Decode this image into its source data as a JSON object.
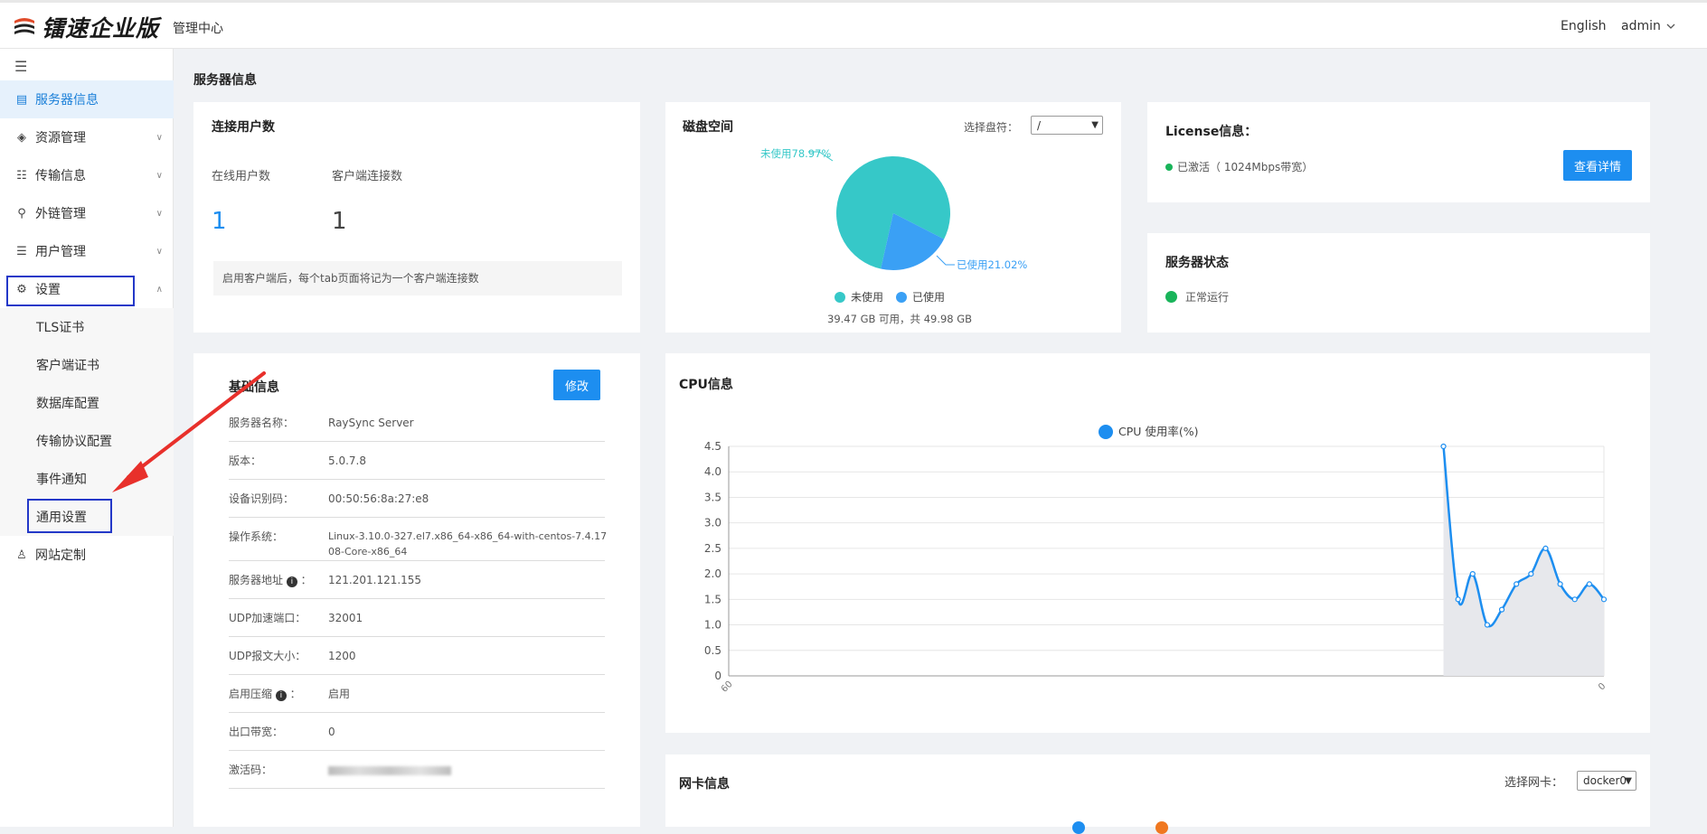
{
  "header": {
    "logo_text": "镭速企业版",
    "center_title": "管理中心",
    "language": "English",
    "user": "admin"
  },
  "sidebar": {
    "items": [
      {
        "label": "服务器信息",
        "icon": "server-list-icon"
      },
      {
        "label": "资源管理",
        "icon": "layers-icon"
      },
      {
        "label": "传输信息",
        "icon": "ordered-list-icon"
      },
      {
        "label": "外链管理",
        "icon": "link-icon"
      },
      {
        "label": "用户管理",
        "icon": "user-list-icon"
      },
      {
        "label": "设置",
        "icon": "gear-icon"
      },
      {
        "label": "网站定制",
        "icon": "shirt-icon"
      }
    ],
    "settings_children": [
      "TLS证书",
      "客户端证书",
      "数据库配置",
      "传输协议配置",
      "事件通知",
      "通用设置"
    ]
  },
  "main": {
    "section_title": "服务器信息",
    "connections": {
      "title": "连接用户数",
      "online_label": "在线用户数",
      "online_value": "1",
      "client_label": "客户端连接数",
      "client_value": "1",
      "note": "启用客户端后，每个tab页面将记为一个客户端连接数"
    },
    "disk": {
      "title": "磁盘空间",
      "selector_label": "选择盘符：",
      "selector_value": "/",
      "unused_label": "未使用78.97%",
      "used_label": "已使用21.02%",
      "legend_unused": "未使用",
      "legend_used": "已使用",
      "summary": "39.47 GB 可用，共 49.98 GB",
      "colors": {
        "unused": "#36c8c8",
        "used": "#3aa0f5"
      },
      "used_percent": 21.02
    },
    "license": {
      "title": "License信息：",
      "status": "已激活（ 1024Mbps带宽）",
      "button": "查看详情"
    },
    "server_status": {
      "title": "服务器状态",
      "status": "正常运行"
    },
    "basic": {
      "title": "基础信息",
      "edit_button": "修改",
      "rows": [
        {
          "label": "服务器名称：",
          "value": "RaySync Server"
        },
        {
          "label": "版本：",
          "value": "5.0.7.8"
        },
        {
          "label": "设备识别码：",
          "value": "00:50:56:8a:27:e8"
        },
        {
          "label": "操作系统：",
          "value": "Linux-3.10.0-327.el7.x86_64-x86_64-with-centos-7.4.1708-Core-x86_64"
        },
        {
          "label": "服务器地址",
          "value": "121.201.121.155",
          "info": true
        },
        {
          "label": "UDP加速端口：",
          "value": "32001"
        },
        {
          "label": "UDP报文大小：",
          "value": "1200"
        },
        {
          "label": "启用压缩",
          "value": "启用",
          "info": true
        },
        {
          "label": "出口带宽：",
          "value": "0"
        },
        {
          "label": "激活码：",
          "value": "",
          "blurred": true
        }
      ]
    },
    "cpu": {
      "title": "CPU信息",
      "legend": "CPU 使用率(%)",
      "x_start_label": "60",
      "x_end_label": "0"
    },
    "nic": {
      "title": "网卡信息",
      "selector_label": "选择网卡：",
      "selector_value": "docker0"
    }
  },
  "chart_data": {
    "type": "area",
    "title": "CPU信息",
    "series": [
      {
        "name": "CPU 使用率(%)",
        "x": [
          49,
          50,
          51,
          52,
          53,
          54,
          55,
          56,
          57,
          58,
          59,
          60
        ],
        "values": [
          4.5,
          1.5,
          2.0,
          1.0,
          1.3,
          1.8,
          2.0,
          2.5,
          1.8,
          1.5,
          1.8,
          1.5
        ]
      }
    ],
    "x_range": [
      0,
      60
    ],
    "ylim": [
      0,
      4.5
    ],
    "yticks": [
      "0",
      "0.5",
      "1.0",
      "1.5",
      "2.0",
      "2.5",
      "3.0",
      "3.5",
      "4.0",
      "4.5"
    ],
    "grid": true,
    "legend_position": "top"
  }
}
